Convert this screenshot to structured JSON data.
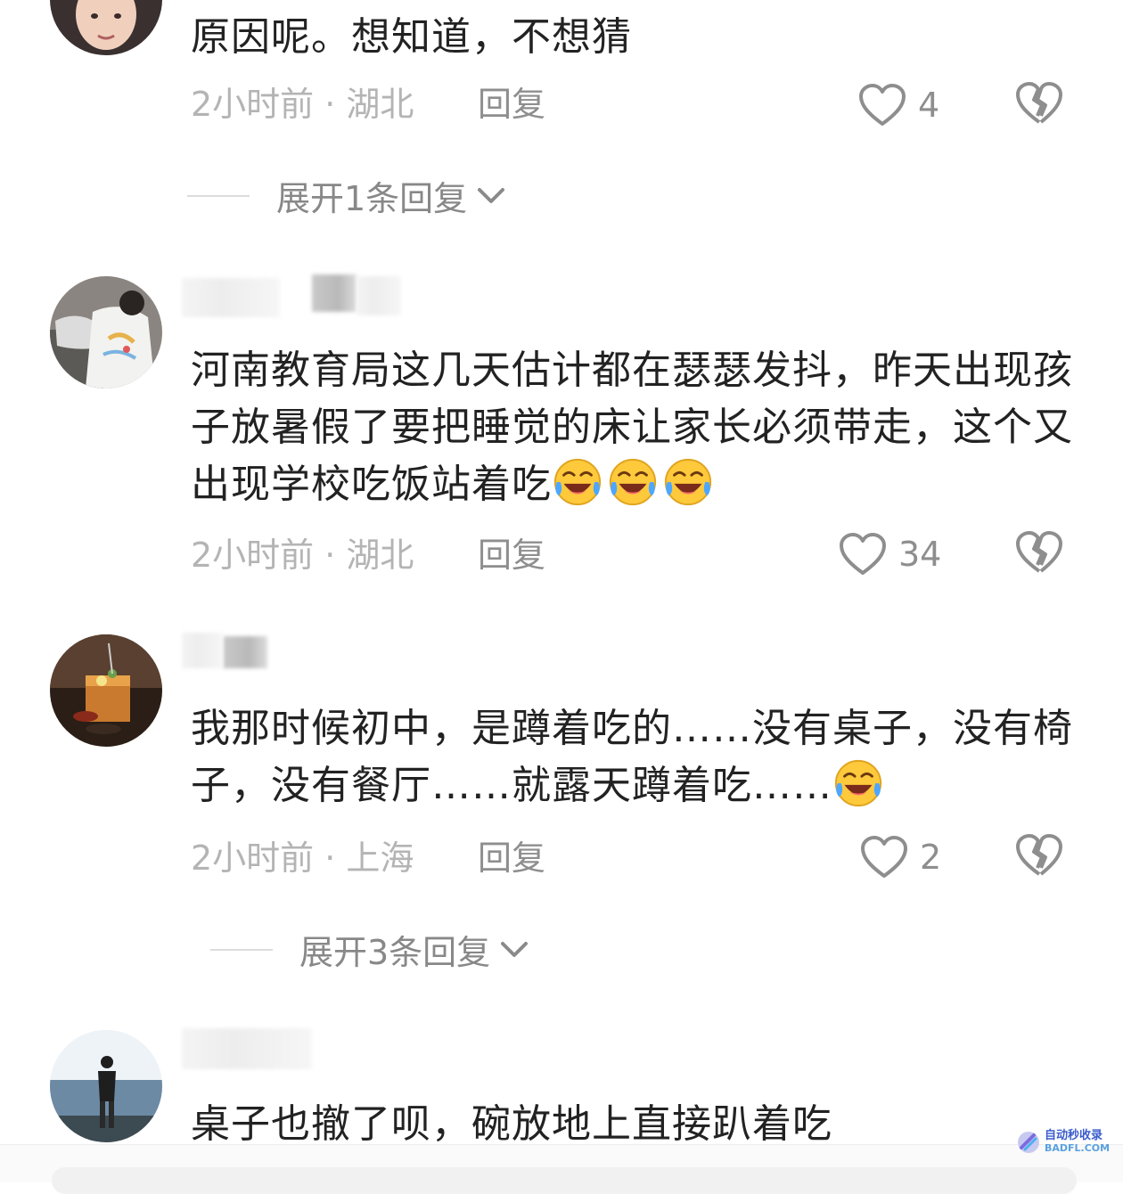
{
  "comments": [
    {
      "text": "原因呢。想知道，不想猜",
      "meta": "2小时前 · 湖北",
      "reply": "回复",
      "likes": "4",
      "expand": "展开1条回复"
    },
    {
      "text": "河南教育局这几天估计都在瑟瑟发抖，昨天出现孩子放暑假了要把睡觉的床让家长必须带走，这个又出现学校吃饭站着吃",
      "emoji_count": 3,
      "meta": "2小时前 · 湖北",
      "reply": "回复",
      "likes": "34"
    },
    {
      "text": "我那时候初中，是蹲着吃的……没有桌子，没有椅子，没有餐厅……就露天蹲着吃……",
      "emoji_count": 1,
      "meta": "2小时前 · 上海",
      "reply": "回复",
      "likes": "2",
      "expand": "展开3条回复"
    },
    {
      "text": "桌子也撤了呗，碗放地上直接趴着吃"
    }
  ],
  "icons": {
    "like": "heart-outline-icon",
    "dislike": "broken-heart-icon",
    "expand": "chevron-down-icon",
    "emoji": "rolling-laughing-emoji"
  },
  "watermark": {
    "cn": "自动秒收录",
    "en": "BADFL.COM"
  },
  "colors": {
    "text": "#222222",
    "meta": "#b4b4b4",
    "secondary": "#8e8e8e"
  }
}
